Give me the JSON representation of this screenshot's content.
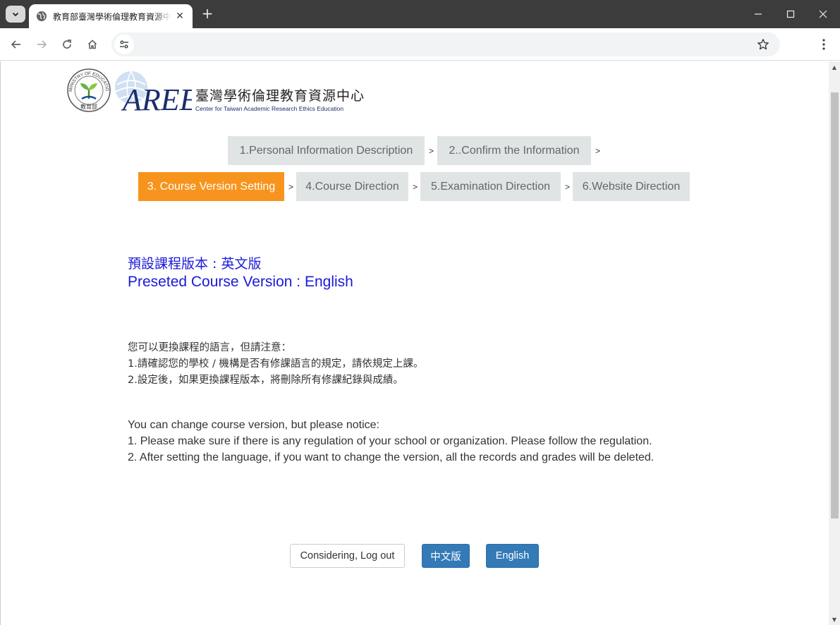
{
  "browser": {
    "tab_title": "教育部臺灣學術倫理教育資源中心",
    "new_tab": "+",
    "address": "",
    "controls": {
      "minimize": "minimize",
      "maximize": "maximize",
      "close": "close"
    }
  },
  "logo": {
    "seal_text": "MINISTRY OF EDUCATION",
    "seal_cn": "教育部",
    "aree": "AREE",
    "cn": "臺灣學術倫理教育資源中心",
    "en": "Center for Taiwan Academic Research Ethics Education"
  },
  "steps": {
    "s1": "1.Personal Information Description",
    "s2": "2..Confirm the Information",
    "s3": "3. Course Version Setting",
    "s4": "4.Course Direction",
    "s5": "5.Examination Direction",
    "s6": "6.Website Direction",
    "separator": ">"
  },
  "preset": {
    "cn": "預設課程版本 : 英文版",
    "en": "Preseted Course Version : English"
  },
  "notice_cn": {
    "line1": "您可以更換課程的語言，但請注意：",
    "line2": "1.請確認您的學校 / 機構是否有修課語言的規定，請依規定上課。",
    "line3": "2.設定後，如果更換課程版本，將刪除所有修課紀錄與成績。"
  },
  "notice_en": {
    "line1": "You can change course version, but please notice:",
    "line2": "1. Please make sure if there is any regulation of your school or organization. Please follow the regulation.",
    "line3": "2. After setting the language, if you want to change the version, all the records and grades will be deleted."
  },
  "buttons": {
    "logout": "Considering, Log out",
    "chinese": "中文版",
    "english": "English"
  },
  "colors": {
    "active_step": "#f7941d",
    "step_bg": "#e0e4e5",
    "preset_text": "#1a1ad9",
    "primary_button": "#337ab7"
  }
}
